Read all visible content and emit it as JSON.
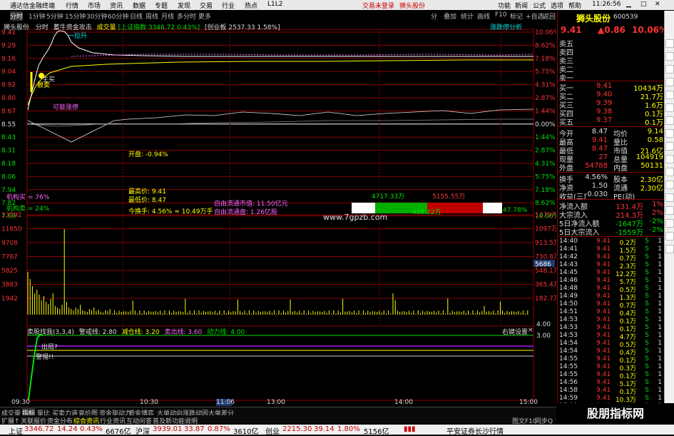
{
  "window": {
    "app_name": "通达信金融终端",
    "menu": [
      "行情",
      "市场",
      "资讯",
      "数据",
      "专题",
      "发现",
      "交易",
      "行业",
      "热点",
      "L1L2"
    ],
    "login_status": "交易未登录",
    "stock_name_header": "狮头股份",
    "right_menu": [
      "功能",
      "新闻",
      "公式",
      "选项",
      "帮助"
    ],
    "clock": "11:26:56"
  },
  "toolbar": {
    "tabs": [
      "分时",
      "1分钟",
      "5分钟",
      "15分钟",
      "30分钟",
      "60分钟",
      "日线",
      "周线",
      "月线",
      "多分时",
      "更多"
    ],
    "right_buttons": [
      "分",
      "叠加",
      "统计",
      "画线",
      "F10",
      "标记",
      "+自选",
      "返回"
    ]
  },
  "chart_header": {
    "stock": "狮头股份",
    "mode": "分时",
    "indicator": "蓄牛资金攻击",
    "volume_label": "成交量",
    "index_label": "[上证指数",
    "index_value": "3346.72 0.43%]",
    "ref_label": "[创业板",
    "ref_value": "2537.33 1.58%]",
    "right_label": "涨跌停分析"
  },
  "price_axis": {
    "left": [
      "9.41",
      "9.29",
      "9.16",
      "9.04",
      "8.92",
      "8.80",
      "8.67",
      "8.55",
      "8.43",
      "8.31",
      "8.18",
      "8.06",
      "7.94",
      "7.82",
      "7.69"
    ],
    "right": [
      "10.06%",
      "8.62%",
      "7.18%",
      "5.75%",
      "4.31%",
      "2.87%",
      "1.44%",
      "0.00%",
      "1.44%",
      "2.87%",
      "4.31%",
      "5.75%",
      "7.18%",
      "8.62%",
      "10.06%"
    ]
  },
  "volume_axis": {
    "left": [
      "13592",
      "11650",
      "9708",
      "7767",
      "5825",
      "3883",
      "1942"
    ],
    "right": [
      "1279万",
      "1097万",
      "913.5万",
      "730.8万",
      "548.1万",
      "365.4万",
      "182.7万"
    ]
  },
  "time_axis": [
    "09:30",
    "10:30",
    "11:06",
    "13:00",
    "14:00",
    "15:00"
  ],
  "annotations": {
    "pull_up": "一拉升",
    "main_buy": "主买",
    "main_sell": "散卖",
    "may_limit": "可能涨停",
    "open_label": "开盘: -0.94%",
    "high_label": "最高价: 9.41",
    "low_label": "最低价: 8.47",
    "turnover": "今换手: 4.56% ≈ 10.49万手",
    "inst_buy": "机构买 = 76%",
    "inst_sell": "机构卖 = 24%",
    "free_cap": "自由流通市值: 11.50亿元",
    "free_float": "自由流通盘: 1.26亿股",
    "bar_left": "4717.33万",
    "bar_mid": "438.22万",
    "bar_right": "5155.55万",
    "bar_pct": "47.78%",
    "watermark": "www.7gpzb.com",
    "vol_marker": "5686"
  },
  "lower_indicator": {
    "title": "卖股找我(3,3,4)",
    "warn": "警戒线: 2.80",
    "reduce": "减仓线: 3.20",
    "exit": "卖出线: 3.60",
    "power": "动力线: 4.00",
    "settings": "右键设置",
    "out_q": "出局?",
    "alert": "警惕!!",
    "axis": [
      "4.00",
      "3.00"
    ]
  },
  "quote": {
    "name": "狮头股份",
    "code": "600539",
    "price": "9.41",
    "change": "▲0.86",
    "pct": "10.06%",
    "sell_labels": [
      "卖五",
      "卖四",
      "卖三",
      "卖二",
      "卖一"
    ],
    "buy": [
      {
        "label": "买一",
        "price": "9.41",
        "vol": "10434万"
      },
      {
        "label": "买二",
        "price": "9.40",
        "vol": "21.7万"
      },
      {
        "label": "买三",
        "price": "9.39",
        "vol": "1.6万"
      },
      {
        "label": "买四",
        "price": "9.38",
        "vol": "0.1万"
      },
      {
        "label": "买五",
        "price": "9.37",
        "vol": "0.1万"
      }
    ],
    "stats": [
      {
        "k1": "今开",
        "v1": "8.47",
        "k2": "均价",
        "v2": "9.14"
      },
      {
        "k1": "最高",
        "v1": "9.41",
        "k2": "量比",
        "v2": "0.58"
      },
      {
        "k1": "最低",
        "v1": "8.47",
        "k2": "市值",
        "v2": "21.6亿"
      },
      {
        "k1": "现量",
        "v1": "27",
        "k2": "总量",
        "v2": "104919"
      },
      {
        "k1": "外盘",
        "v1": "54788",
        "k2": "内盘",
        "v2": "50131"
      }
    ],
    "stats2": [
      {
        "k1": "换手",
        "v1": "4.56%",
        "k2": "股本",
        "v2": "2.30亿"
      },
      {
        "k1": "净资",
        "v1": "1.50",
        "k2": "流通",
        "v2": "2.30亿"
      },
      {
        "k1": "收益(三)",
        "v1": "-0.030",
        "k2": "PE(动)",
        "v2": ""
      }
    ],
    "flows": [
      {
        "label": "净流入额",
        "value": "131.4万",
        "pct": "1%"
      },
      {
        "label": "大宗流入",
        "value": "214.3万",
        "pct": "2%"
      },
      {
        "label": "5日净流入额",
        "value": "-1647万",
        "pct": "-2%"
      },
      {
        "label": "5日大宗流入",
        "value": "-1559万",
        "pct": "-2%"
      }
    ],
    "ticks": [
      {
        "t": "14:40",
        "p": "9.41",
        "v": "0.2万",
        "s": "S",
        "n": "1"
      },
      {
        "t": "14:41",
        "p": "9.41",
        "v": "1.5万",
        "s": "S",
        "n": "1"
      },
      {
        "t": "14:42",
        "p": "9.41",
        "v": "0.7万",
        "s": "S",
        "n": "1"
      },
      {
        "t": "14:43",
        "p": "9.41",
        "v": "2.3万",
        "s": "S",
        "n": "1"
      },
      {
        "t": "14:45",
        "p": "9.41",
        "v": "12.2万",
        "s": "S",
        "n": "1"
      },
      {
        "t": "14:46",
        "p": "9.41",
        "v": "5.7万",
        "s": "S",
        "n": "1"
      },
      {
        "t": "14:48",
        "p": "9.41",
        "v": "0.5万",
        "s": "S",
        "n": "1"
      },
      {
        "t": "14:49",
        "p": "9.41",
        "v": "1.3万",
        "s": "S",
        "n": "1"
      },
      {
        "t": "14:50",
        "p": "9.41",
        "v": "0.7万",
        "s": "S",
        "n": "1"
      },
      {
        "t": "14:51",
        "p": "9.41",
        "v": "0.4万",
        "s": "S",
        "n": "1"
      },
      {
        "t": "14:53",
        "p": "9.41",
        "v": "0.1万",
        "s": "S",
        "n": "1"
      },
      {
        "t": "14:53",
        "p": "9.41",
        "v": "0.1万",
        "s": "S",
        "n": "1"
      },
      {
        "t": "14:53",
        "p": "9.41",
        "v": "4.7万",
        "s": "S",
        "n": "1"
      },
      {
        "t": "14:54",
        "p": "9.41",
        "v": "0.5万",
        "s": "S",
        "n": "1"
      },
      {
        "t": "14:54",
        "p": "9.41",
        "v": "0.4万",
        "s": "S",
        "n": "1"
      },
      {
        "t": "14:55",
        "p": "9.41",
        "v": "0.1万",
        "s": "S",
        "n": "1"
      },
      {
        "t": "14:55",
        "p": "9.41",
        "v": "0.3万",
        "s": "S",
        "n": "1"
      },
      {
        "t": "14:55",
        "p": "9.41",
        "v": "0.1万",
        "s": "S",
        "n": "1"
      },
      {
        "t": "14:56",
        "p": "9.41",
        "v": "5.1万",
        "s": "S",
        "n": "1"
      },
      {
        "t": "14:58",
        "p": "9.41",
        "v": "0.1万",
        "s": "S",
        "n": "1"
      },
      {
        "t": "14:59",
        "p": "9.41",
        "v": "10.3万",
        "s": "S",
        "n": "1"
      },
      {
        "t": "15:00",
        "p": "9.41",
        "v": "0.1万",
        "s": "S",
        "n": "1"
      }
    ]
  },
  "bottom_tabs": [
    "成交量",
    "指标",
    "量比",
    "买卖力道",
    "竟价图",
    "资金驱动力",
    "资金博弈",
    "大单动向",
    "涨跌动因",
    "大单差分"
  ],
  "bottom_tabs2": [
    "扩展↑",
    "关联报价",
    "资金分布",
    "综合资讯",
    "行业资讯",
    "互动问答",
    "普及新功能说明"
  ],
  "bottom_right": [
    "图文F10",
    "同步Q"
  ],
  "status": {
    "idx1_name": "上证",
    "idx1_val": "3346.72",
    "idx1_chg": "14.24",
    "idx1_pct": "0.43%",
    "idx1_amt": "6676亿",
    "idx2_name": "沪深",
    "idx2_val": "3939.01",
    "idx2_chg": "33.87",
    "idx2_pct": "0.87%",
    "idx2_amt": "3610亿",
    "idx3_name": "创业",
    "idx3_val": "2215.30",
    "idx3_chg": "39.14",
    "idx3_pct": "1.80%",
    "idx3_amt": "5156亿",
    "broker": "平安证券长沙行情"
  },
  "ad": "股朋指标网"
}
